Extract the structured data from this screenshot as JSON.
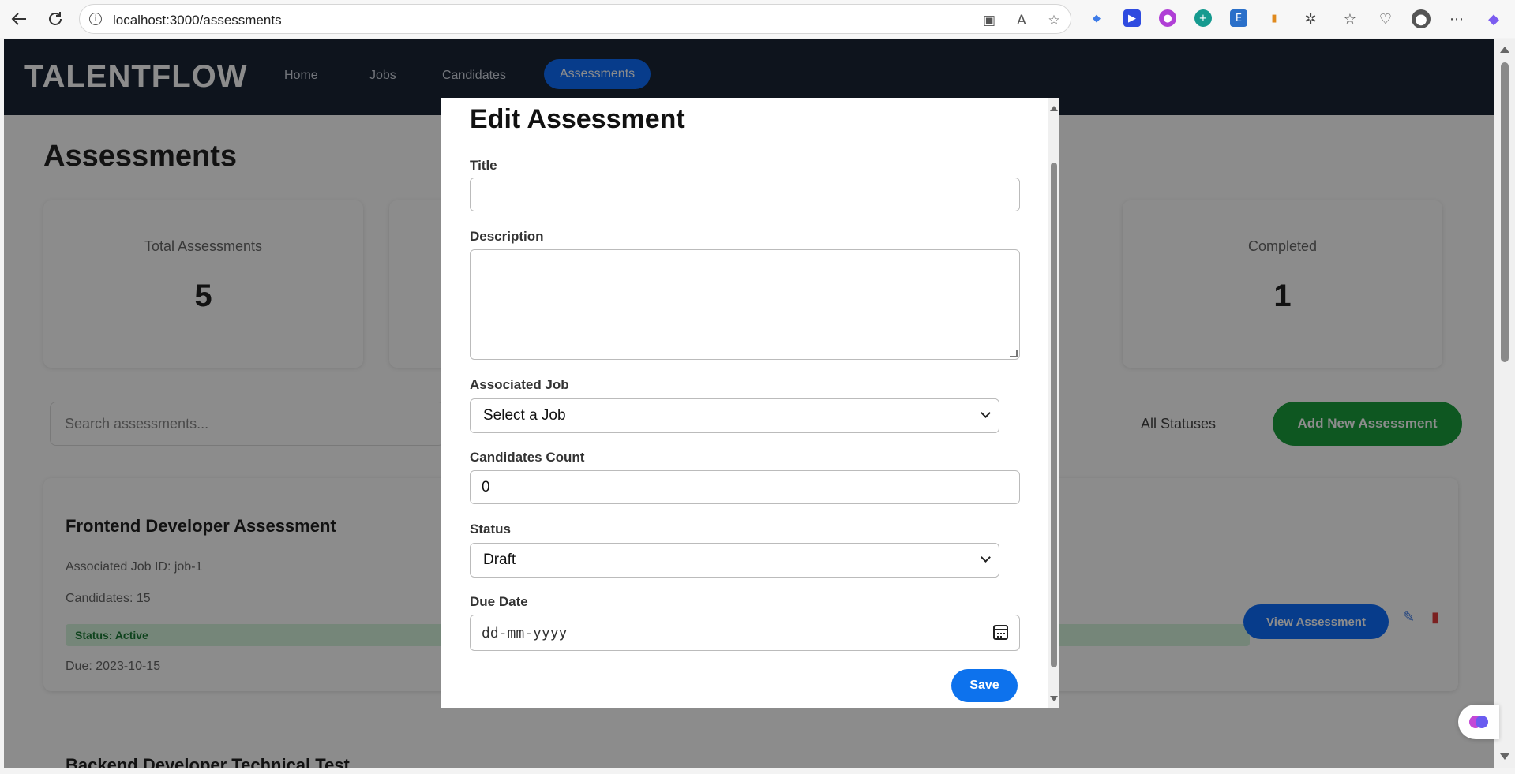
{
  "browser": {
    "url": "localhost:3000/assessments",
    "back_icon": "back-arrow-icon",
    "reload_icon": "reload-icon"
  },
  "app": {
    "brand": "TALENTFLOW",
    "nav": [
      "Home",
      "Jobs",
      "Candidates",
      "Assessments"
    ],
    "page_title": "Assessments",
    "stats": [
      {
        "label": "Total Assessments",
        "value": "5"
      },
      {
        "label": "Completed",
        "value": "1"
      }
    ],
    "search_placeholder": "Search assessments...",
    "filter": "All Statuses",
    "add_button": "Add New Assessment",
    "card": {
      "title": "Frontend Developer Assessment",
      "job": "Associated Job ID: job-1",
      "candidates": "Candidates: 15",
      "status": "Status: Active",
      "due": "Due: 2023-10-15",
      "view_button": "View Assessment"
    },
    "next_card_title": "Backend Developer Technical Test"
  },
  "modal": {
    "title": "Edit Assessment",
    "fields": {
      "title_label": "Title",
      "title_value": "",
      "description_label": "Description",
      "description_value": "",
      "job_label": "Associated Job",
      "job_value": "Select a Job",
      "candidates_label": "Candidates Count",
      "candidates_value": "0",
      "status_label": "Status",
      "status_value": "Draft",
      "due_label": "Due Date",
      "due_placeholder": "dd-mm-yyyy"
    },
    "save_label": "Save"
  },
  "colors": {
    "primary": "#0d72ed",
    "success": "#1a9f3d",
    "nav_bg": "#1b2535"
  }
}
